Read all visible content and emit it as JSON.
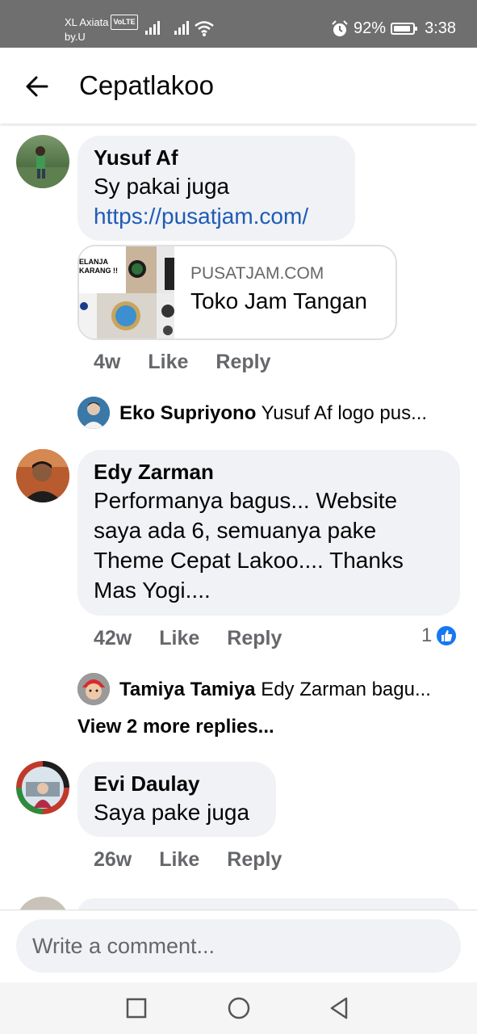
{
  "status_bar": {
    "carrier": "XL Axiata",
    "volte": "VoLTE",
    "carrier_sub": "by.U",
    "battery": "92%",
    "battery_level": 0.92,
    "time": "3:38"
  },
  "header": {
    "title": "Cepatlakoo"
  },
  "comments": [
    {
      "name": "Yusuf Af",
      "text": "Sy pakai juga",
      "link": "https://pusatjam.com/",
      "preview": {
        "domain": "PUSATJAM.COM",
        "title": "Toko Jam Tangan",
        "thumb_text_1": "ELANJA",
        "thumb_text_2": "KARANG !!"
      },
      "time": "4w",
      "like": "Like",
      "reply": "Reply",
      "reply_preview": {
        "name": "Eko Supriyono",
        "text": "Yusuf Af logo pus..."
      }
    },
    {
      "name": "Edy Zarman",
      "text_lines": [
        "Performanya bagus... Website",
        "saya ada 6, semuanya pake",
        "Theme Cepat Lakoo.... Thanks",
        "Mas Yogi...."
      ],
      "time": "42w",
      "like": "Like",
      "reply": "Reply",
      "reaction_count": "1",
      "reply_preview": {
        "name": "Tamiya Tamiya",
        "text": "Edy Zarman bagu..."
      },
      "more_replies": "View 2 more replies..."
    },
    {
      "name": "Evi Daulay",
      "text": "Saya pake juga",
      "time": "26w",
      "like": "Like",
      "reply": "Reply"
    }
  ],
  "composer": {
    "placeholder": "Write a comment..."
  },
  "colors": {
    "link": "#1f5bb6",
    "bubble": "#f0f2f5",
    "muted": "#65676b",
    "like_blue": "#1877f2"
  },
  "icons": [
    "back-arrow-icon",
    "signal-icon",
    "wifi-icon",
    "alarm-icon",
    "battery-icon",
    "like-reaction-icon",
    "recent-apps-icon",
    "home-icon",
    "back-icon"
  ]
}
